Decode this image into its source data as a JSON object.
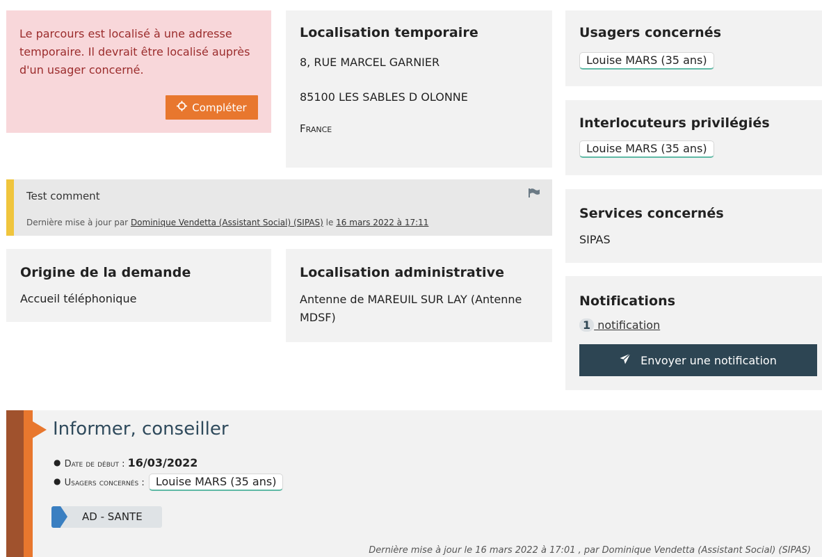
{
  "alert": {
    "message": "Le parcours est localisé à une adresse temporaire. Il devrait être localisé auprès d'un usager concerné.",
    "button_label": "Compléter",
    "button_icon": "crosshair-icon"
  },
  "temp_location": {
    "title": "Localisation temporaire",
    "street": "8, RUE MARCEL GARNIER",
    "city": "85100 LES SABLES D OLONNE",
    "country": "France"
  },
  "concerned_users": {
    "title": "Usagers concernés",
    "items": [
      "Louise MARS (35 ans)"
    ]
  },
  "privileged_contacts": {
    "title": "Interlocuteurs privilégiés",
    "items": [
      "Louise MARS (35 ans)"
    ]
  },
  "comment": {
    "text": "Test comment",
    "updated_prefix": "Dernière mise à jour par ",
    "author": "Dominique Vendetta (Assistant Social) (SIPAS)",
    "date_prefix": " le ",
    "date": "16 mars 2022 à 17:11",
    "flag_icon": "flag-icon"
  },
  "concerned_services": {
    "title": "Services concernés",
    "value": "SIPAS"
  },
  "origin": {
    "title": "Origine de la demande",
    "value": "Accueil téléphonique"
  },
  "admin_location": {
    "title": "Localisation administrative",
    "value": "Antenne de MAREUIL SUR LAY (Antenne MDSF)"
  },
  "notifications": {
    "title": "Notifications",
    "count": "1",
    "link_label": " notification",
    "send_button": "Envoyer une notification",
    "send_icon": "paper-plane-icon"
  },
  "step": {
    "title": "Informer, conseiller",
    "start_date_label": "Date de début",
    "start_date_sep": " : ",
    "start_date_value": "16/03/2022",
    "users_label": "Usagers concernés",
    "users_sep": " : ",
    "users_value": "Louise MARS (35 ans)",
    "tag": "AD - SANTE",
    "footer": "Dernière mise à jour le 16 mars 2022 à 17:01 , par Dominique Vendetta (Assistant Social) (SIPAS)"
  },
  "colors": {
    "alert_bg": "#f8d7da",
    "alert_text": "#9b2c2c",
    "orange": "#e8772e",
    "dark_button": "#2d4553",
    "comment_bar": "#f0c53d",
    "pill_underline": "#5fb9a5",
    "step_dark": "#a0522d",
    "tag_blue": "#3a7fc1",
    "step_title": "#2f4a5c"
  }
}
